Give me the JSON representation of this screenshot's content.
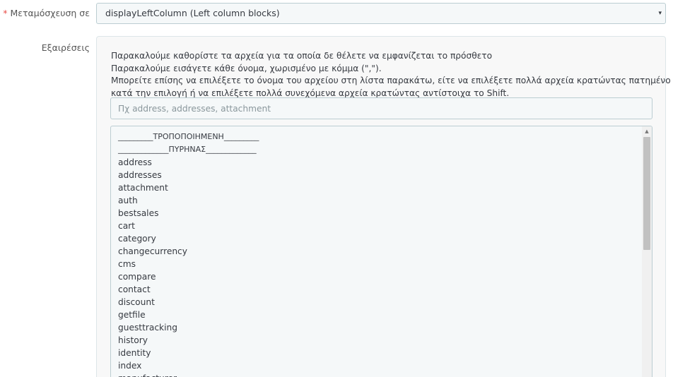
{
  "transplant": {
    "required_mark": "*",
    "label": "Μεταμόσχευση σε",
    "selected": "displayLeftColumn (Left column blocks)",
    "caret_icon": "▾"
  },
  "exceptions": {
    "label": "Εξαιρέσεις",
    "help": {
      "line1": "Παρακαλούμε καθορίστε τα αρχεία για τα οποία δε θέλετε να εμφανίζεται το πρόσθετο",
      "line2": "Παρακαλούμε εισάγετε κάθε όνομα, χωρισμένο με κόμμα (\",\").",
      "line3": "Μπορείτε επίσης να επιλέξετε το όνομα του αρχείου στη λίστα παρακάτω, είτε να επιλέξετε πολλά αρχεία κρατώντας πατημένο το Ctrl",
      "line4": "κατά την επιλογή ή να επιλέξετε πολλά συνεχόμενα αρχεία κρατώντας αντίστοιχα το Shift."
    },
    "input_value": "",
    "input_placeholder": "Πχ address, addresses, attachment",
    "list": {
      "header_custom": "_________ΤΡΟΠΟΠΟΙΗΜΕΝΗ_________",
      "header_core": "_____________ΠΥΡΗΝΑΣ_____________",
      "items": [
        "address",
        "addresses",
        "attachment",
        "auth",
        "bestsales",
        "cart",
        "category",
        "changecurrency",
        "cms",
        "compare",
        "contact",
        "discount",
        "getfile",
        "guesttracking",
        "history",
        "identity",
        "index",
        "manufacturer"
      ],
      "scroll_up_icon": "▲"
    }
  }
}
